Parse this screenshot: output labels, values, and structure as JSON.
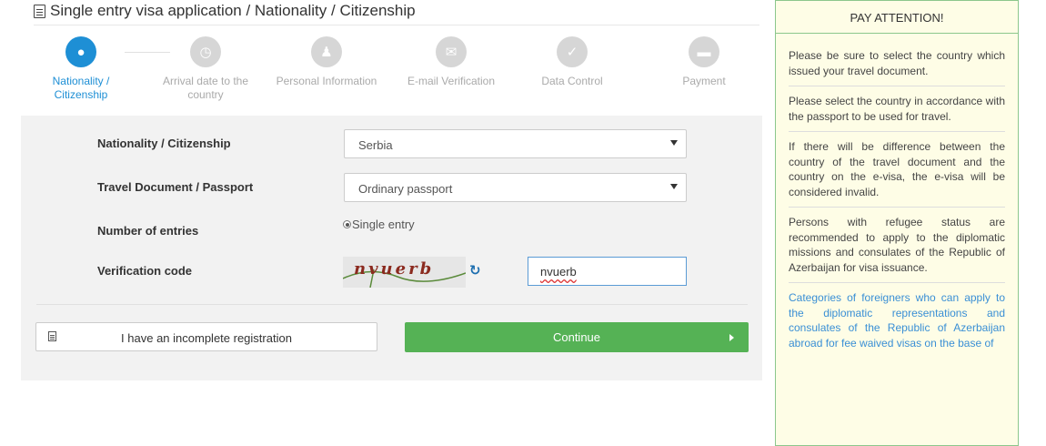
{
  "header": {
    "title": "Single entry visa application / Nationality / Citizenship",
    "title_icon": "document-icon"
  },
  "steps": [
    {
      "label": "Nationality / Citizenship",
      "icon": "globe-icon",
      "active": true
    },
    {
      "label": "Arrival date to the country",
      "icon": "clock-icon",
      "active": false
    },
    {
      "label": "Personal Information",
      "icon": "user-icon",
      "active": false
    },
    {
      "label": "E-mail Verification",
      "icon": "envelope-icon",
      "active": false
    },
    {
      "label": "Data Control",
      "icon": "check-icon",
      "active": false
    },
    {
      "label": "Payment",
      "icon": "credit-card-icon",
      "active": false
    }
  ],
  "form": {
    "nationality_label": "Nationality / Citizenship",
    "nationality_value": "Serbia",
    "document_label": "Travel Document / Passport",
    "document_value": "Ordinary passport",
    "entries_label": "Number of entries",
    "entries_value": "Single entry",
    "verification_label": "Verification code",
    "captcha_text": "nvuerb",
    "verification_value": "nvuerb"
  },
  "buttons": {
    "incomplete": "I have an incomplete registration",
    "continue": "Continue"
  },
  "side": {
    "title": "PAY ATTENTION!",
    "p1": "Please be sure to select the country which issued your travel document.",
    "p2": "Please select the country in accordance with the passport to be used for travel.",
    "p3": "If there will be difference between the country of the travel document and the country on the e-visa, the e-visa will be considered invalid.",
    "p4": "Persons with refugee status are recommended to apply to the diplomatic missions and consulates of the Republic of Azerbaijan for visa issuance.",
    "p5": "Categories of foreigners who can apply to the diplomatic representations and consulates of the Republic of Azerbaijan abroad for fee waived visas on the base of"
  },
  "colors": {
    "accent": "#1e8fd5",
    "continue": "#55b255",
    "side_bg": "#fefde6",
    "side_border": "#8cc78c"
  }
}
